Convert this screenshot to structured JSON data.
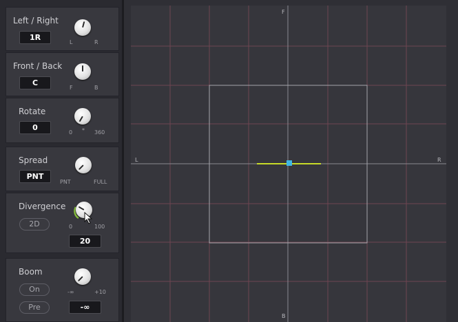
{
  "left_right": {
    "label": "Left / Right",
    "value": "1R",
    "min_label": "L",
    "max_label": "R"
  },
  "front_back": {
    "label": "Front / Back",
    "value": "C",
    "min_label": "F",
    "max_label": "B"
  },
  "rotate": {
    "label": "Rotate",
    "value": "0",
    "min_label": "0",
    "mid_label": "*",
    "max_label": "360"
  },
  "spread": {
    "label": "Spread",
    "value": "PNT",
    "min_label": "PNT",
    "max_label": "FULL"
  },
  "divergence": {
    "label": "Divergence",
    "mode_button": "2D",
    "min_label": "0",
    "max_label": "100",
    "value": "20"
  },
  "boom": {
    "label": "Boom",
    "on_button": "On",
    "pre_button": "Pre",
    "min_label": "-∞",
    "max_label": "+10",
    "value": "-∞"
  },
  "pan_area": {
    "top_label": "F",
    "bottom_label": "B",
    "left_label": "L",
    "right_label": "R"
  },
  "colors": {
    "grid_line": "#7a4a58",
    "axis_line": "#8a8a92",
    "spread_line": "#c8dc28",
    "puck": "#3fb6e6",
    "divergence_arc": "#8cc63f"
  }
}
